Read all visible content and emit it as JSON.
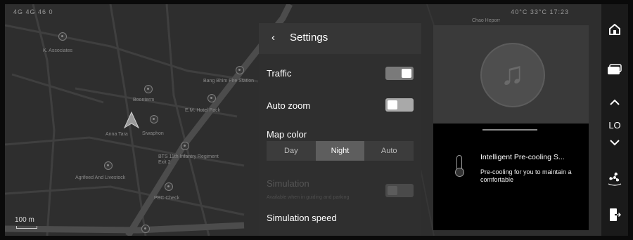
{
  "status_bar": {
    "left": "4G 4G 46 0",
    "right": "40°C 33°C 17:23"
  },
  "map": {
    "labels": [
      "K. Associates",
      "Bang Bhim Fire Station",
      "Boonterm",
      "E.M. Hotel Pack",
      "Anna Tara",
      "Siwaphon",
      "BTS 11th Infantry Regiment Exit 2",
      "Agrifeed And Livestock",
      "PBC Check",
      "Chao Heporr"
    ],
    "scale_label": "100 m"
  },
  "settings": {
    "back_glyph": "‹",
    "title": "Settings",
    "traffic": {
      "label": "Traffic",
      "on": true
    },
    "auto_zoom": {
      "label": "Auto zoom",
      "on": false
    },
    "map_color": {
      "label": "Map color",
      "options": [
        "Day",
        "Night",
        "Auto"
      ],
      "selected": "Night"
    },
    "simulation": {
      "label": "Simulation",
      "hint": "Available when in guiding and parking",
      "enabled": false
    },
    "simulation_speed": {
      "label": "Simulation speed"
    }
  },
  "media": {
    "icon": "music-note-icon"
  },
  "notification": {
    "icon": "thermometer-icon",
    "title": "Intelligent Pre-cooling S...",
    "body": "Pre-cooling for you to maintain a comfortable"
  },
  "dock": {
    "home_icon": "home-icon",
    "screen_icon": "display-icon",
    "temp_up_icon": "chevron-up-icon",
    "temp_label": "LO",
    "temp_down_icon": "chevron-down-icon",
    "fan_icon": "fan-icon",
    "exit_icon": "exit-door-icon"
  },
  "colors": {
    "map_bg": "#2e2e2e",
    "panel_bg": "#2f2f2f",
    "dock_bg": "#1a1a1a",
    "selected_segment": "#5e5e5e"
  }
}
